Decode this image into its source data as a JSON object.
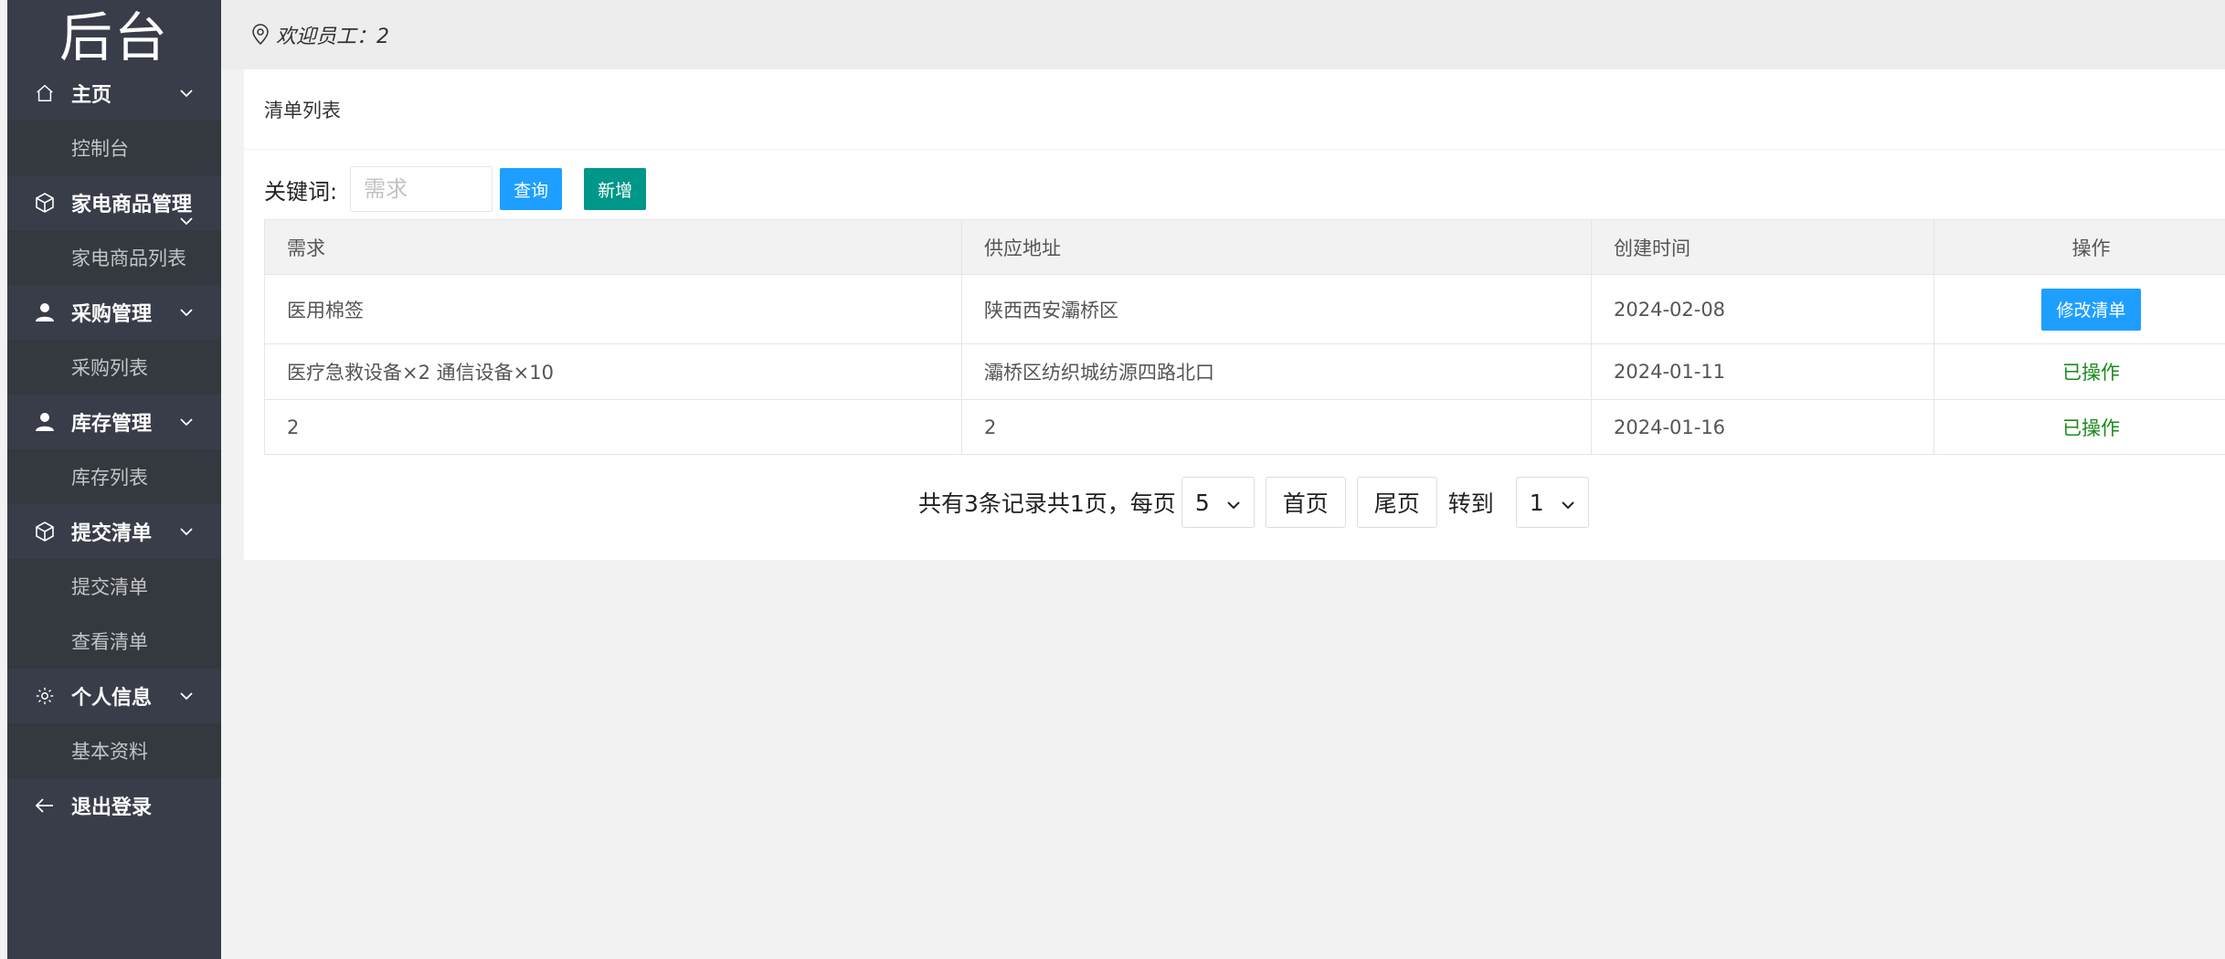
{
  "sidebar": {
    "logo": "后台",
    "groups": [
      {
        "label": "主页",
        "icon": "home-icon",
        "items": [
          "控制台"
        ]
      },
      {
        "label": "家电商品管理",
        "icon": "box-icon",
        "items": [
          "家电商品列表"
        ]
      },
      {
        "label": "采购管理",
        "icon": "user-icon",
        "items": [
          "采购列表"
        ]
      },
      {
        "label": "库存管理",
        "icon": "user-icon",
        "items": [
          "库存列表"
        ]
      },
      {
        "label": "提交清单",
        "icon": "box-icon",
        "items": [
          "提交清单",
          "查看清单"
        ]
      },
      {
        "label": "个人信息",
        "icon": "gear-icon",
        "items": [
          "基本资料"
        ]
      }
    ],
    "logout": {
      "label": "退出登录",
      "icon": "arrow-left-icon"
    }
  },
  "header": {
    "welcome": "欢迎员工：2",
    "icon": "location-pin-icon"
  },
  "card": {
    "title": "清单列表",
    "search": {
      "label": "关键词:",
      "placeholder": "需求",
      "query_label": "查询",
      "add_label": "新增"
    },
    "columns": [
      "需求",
      "供应地址",
      "创建时间",
      "操作"
    ],
    "rows": [
      {
        "need": "医用棉签",
        "address": "陕西西安灞桥区",
        "created": "2024-02-08",
        "action": "修改清单",
        "action_type": "button"
      },
      {
        "need": "医疗急救设备×2 通信设备×10",
        "address": "灞桥区纺织城纺源四路北口",
        "created": "2024-01-11",
        "action": "已操作",
        "action_type": "text"
      },
      {
        "need": "2",
        "address": "2",
        "created": "2024-01-16",
        "action": "已操作",
        "action_type": "text"
      }
    ],
    "pager": {
      "summary": "共有3条记录共1页，每页",
      "page_size": "5",
      "first": "首页",
      "last": "尾页",
      "goto": "转到",
      "page": "1"
    }
  },
  "colors": {
    "sidebar": "#393d49",
    "blue": "#1e9fff",
    "green": "#009688",
    "done": "#1b8a1b"
  }
}
